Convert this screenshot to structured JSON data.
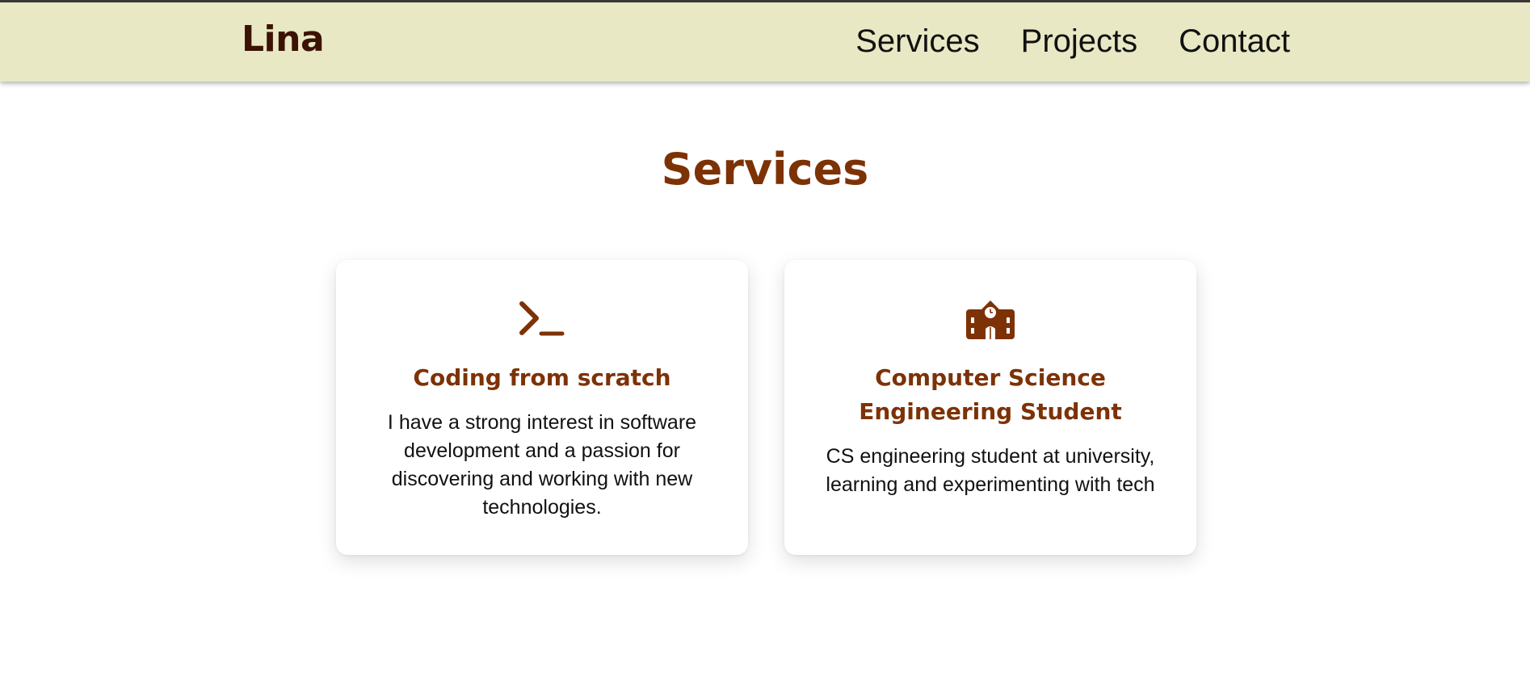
{
  "brand": {
    "logo": "Lina"
  },
  "nav": {
    "items": [
      "Services",
      "Projects",
      "Contact"
    ]
  },
  "services": {
    "title": "Services",
    "cards": [
      {
        "icon": "terminal-prompt-icon",
        "title": "Coding from scratch",
        "description": "I have a strong interest in software development and a passion for discovering and working with new technologies."
      },
      {
        "icon": "school-building-icon",
        "title": "Computer Science Engineering Student",
        "description": "CS engineering student at university, learning and experimenting with tech"
      }
    ]
  },
  "colors": {
    "navbar_bg": "#e8e8c5",
    "accent": "#7d3206",
    "logo": "#3b1203",
    "text": "#111111"
  }
}
